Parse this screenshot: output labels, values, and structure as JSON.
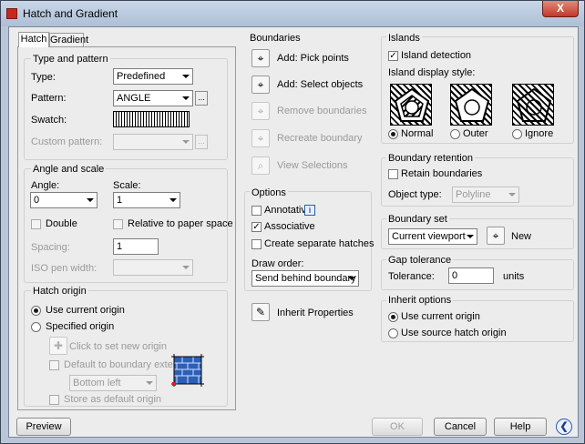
{
  "window": {
    "title": "Hatch and Gradient",
    "close_glyph": "X"
  },
  "tabs": [
    {
      "label": "Hatch"
    },
    {
      "label": "Gradient"
    }
  ],
  "type_pattern": {
    "title": "Type and pattern",
    "type_label": "Type:",
    "type_value": "Predefined",
    "pattern_label": "Pattern:",
    "pattern_value": "ANGLE",
    "swatch_label": "Swatch:",
    "custom_label": "Custom pattern:",
    "ellipsis": "..."
  },
  "angle_scale": {
    "title": "Angle and scale",
    "angle_label": "Angle:",
    "angle_value": "0",
    "scale_label": "Scale:",
    "scale_value": "1",
    "double_label": "Double",
    "relative_label": "Relative to paper space",
    "spacing_label": "Spacing:",
    "spacing_value": "1",
    "iso_label": "ISO pen width:"
  },
  "hatch_origin": {
    "title": "Hatch origin",
    "use_current": "Use current origin",
    "specified": "Specified origin",
    "click_set": "Click to set new origin",
    "default_extents": "Default to boundary extents",
    "position_value": "Bottom left",
    "store_default": "Store as default origin"
  },
  "boundaries": {
    "title": "Boundaries",
    "add_pick": "Add: Pick points",
    "add_select": "Add: Select objects",
    "remove": "Remove boundaries",
    "recreate": "Recreate boundary",
    "view": "View Selections"
  },
  "options": {
    "title": "Options",
    "annotative": "Annotative",
    "info_glyph": "i",
    "associative": "Associative",
    "separate": "Create separate hatches",
    "draw_order_label": "Draw order:",
    "draw_order_value": "Send behind boundary",
    "inherit": "Inherit Properties"
  },
  "islands": {
    "title": "Islands",
    "detection": "Island detection",
    "style_label": "Island display style:",
    "normal": "Normal",
    "outer": "Outer",
    "ignore": "Ignore"
  },
  "retention": {
    "title": "Boundary retention",
    "retain": "Retain boundaries",
    "object_type_label": "Object type:",
    "object_type_value": "Polyline"
  },
  "boundary_set": {
    "title": "Boundary set",
    "value": "Current viewport",
    "new_label": "New"
  },
  "gap": {
    "title": "Gap tolerance",
    "label": "Tolerance:",
    "value": "0",
    "units": "units"
  },
  "inherit_options": {
    "title": "Inherit options",
    "use_current": "Use current origin",
    "use_source": "Use source hatch origin"
  },
  "footer": {
    "preview": "Preview",
    "ok": "OK",
    "cancel": "Cancel",
    "help": "Help",
    "collapse_glyph": "❮"
  }
}
